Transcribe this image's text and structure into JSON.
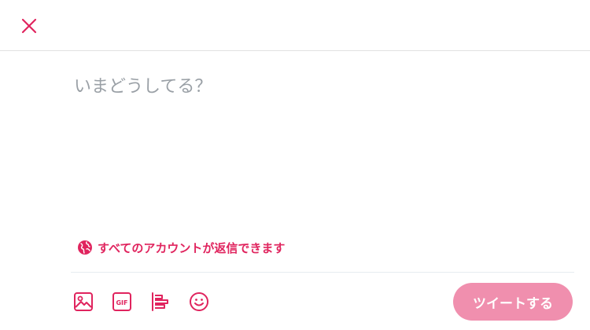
{
  "header": {
    "close_icon": "close-icon",
    "accent_color": "#e0245e"
  },
  "composer": {
    "placeholder": "いまどうしてる？",
    "value": ""
  },
  "reply_setting": {
    "label": "すべてのアカウントが返信できます",
    "icon": "globe-icon"
  },
  "toolbar": {
    "tools": [
      {
        "name": "image",
        "icon": "image-icon"
      },
      {
        "name": "gif",
        "icon": "gif-icon",
        "text": "GIF"
      },
      {
        "name": "poll",
        "icon": "poll-icon"
      },
      {
        "name": "emoji",
        "icon": "emoji-icon"
      }
    ],
    "tweet_label": "ツイートする",
    "tweet_button_color": "#f08fae"
  }
}
